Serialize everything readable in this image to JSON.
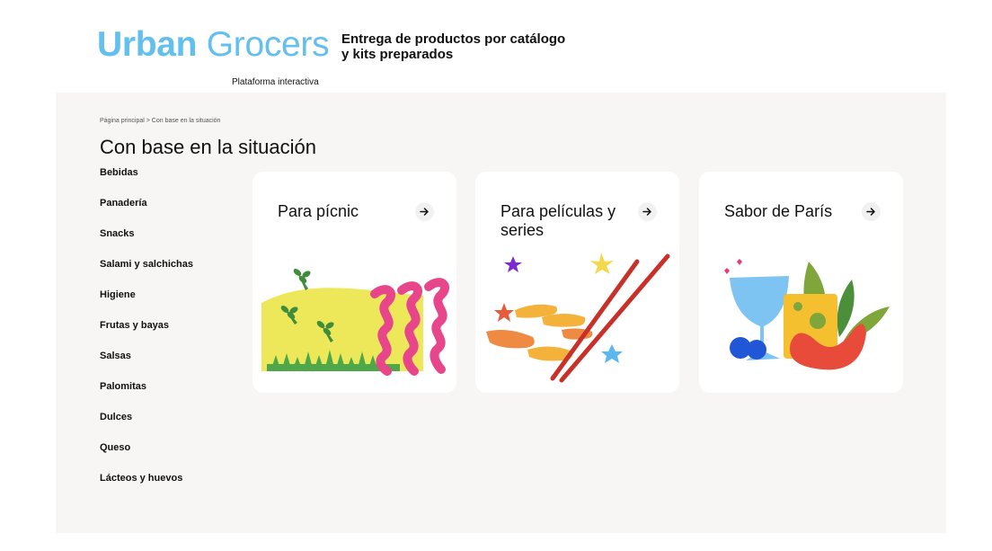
{
  "header": {
    "logo_bold": "Urban",
    "logo_light": "Grocers",
    "logo_sub": "Plataforma interactiva",
    "tagline_line1": "Entrega de productos por catálogo",
    "tagline_line2": "y kits preparados"
  },
  "breadcrumb": "Página principal > Con base en la situación",
  "page_title": "Con base en la situación",
  "sidebar": {
    "items": [
      {
        "label": "Bebidas"
      },
      {
        "label": "Panadería"
      },
      {
        "label": "Snacks"
      },
      {
        "label": "Salami y salchichas"
      },
      {
        "label": "Higiene"
      },
      {
        "label": "Frutas y bayas"
      },
      {
        "label": "Salsas"
      },
      {
        "label": "Palomitas"
      },
      {
        "label": "Dulces"
      },
      {
        "label": "Queso"
      },
      {
        "label": "Lácteos y huevos"
      }
    ]
  },
  "cards": [
    {
      "title": "Para pícnic",
      "icon": "arrow-right-icon"
    },
    {
      "title": "Para películas y series",
      "icon": "arrow-right-icon"
    },
    {
      "title": "Sabor de París",
      "icon": "arrow-right-icon"
    }
  ],
  "colors": {
    "brand": "#63bfee",
    "panel_bg": "#f7f6f4",
    "card_bg": "#ffffff"
  }
}
